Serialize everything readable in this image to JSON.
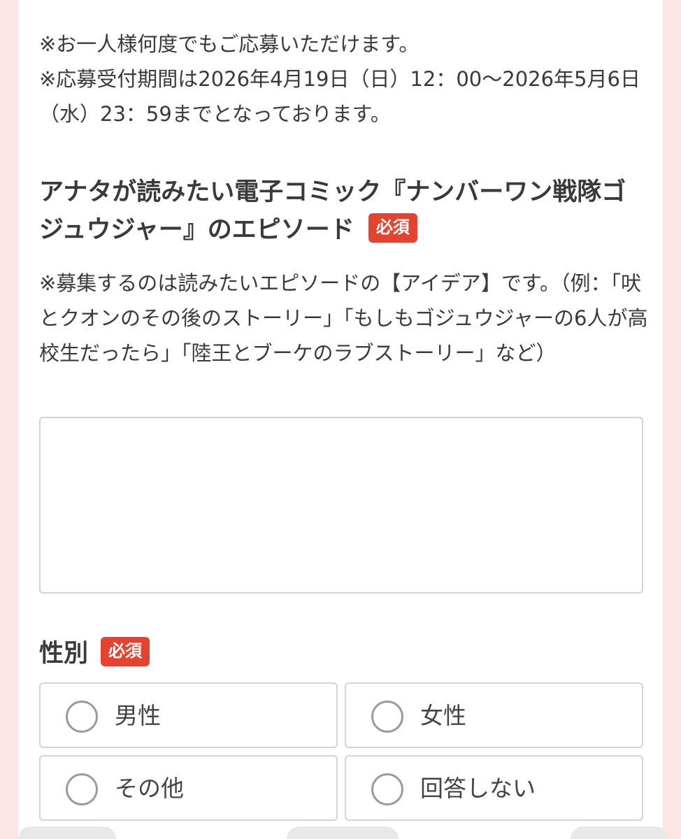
{
  "notes": [
    "※お一人様何度でもご応募いただけます。",
    "※応募受付期間は2026年4月19日（日）12：00〜2026年5月6日（水）23：59までとなっております。"
  ],
  "episode": {
    "label": "アナタが読みたい電子コミック『ナンバーワン戦隊ゴジュウジャー』のエピソード",
    "required_badge": "必須",
    "hint": "※募集するのは読みたいエピソードの【アイデア】です。（例：「吠とクオンのその後のストーリー」「もしもゴジュウジャーの6人が高校生だったら」「陸王とブーケのラブストーリー」など）",
    "value": ""
  },
  "gender": {
    "label": "性別",
    "required_badge": "必須",
    "options": [
      "男性",
      "女性",
      "その他",
      "回答しない"
    ]
  },
  "colors": {
    "background": "#fbe4e4",
    "badge": "#e4432f",
    "border": "#d3d3d3"
  }
}
